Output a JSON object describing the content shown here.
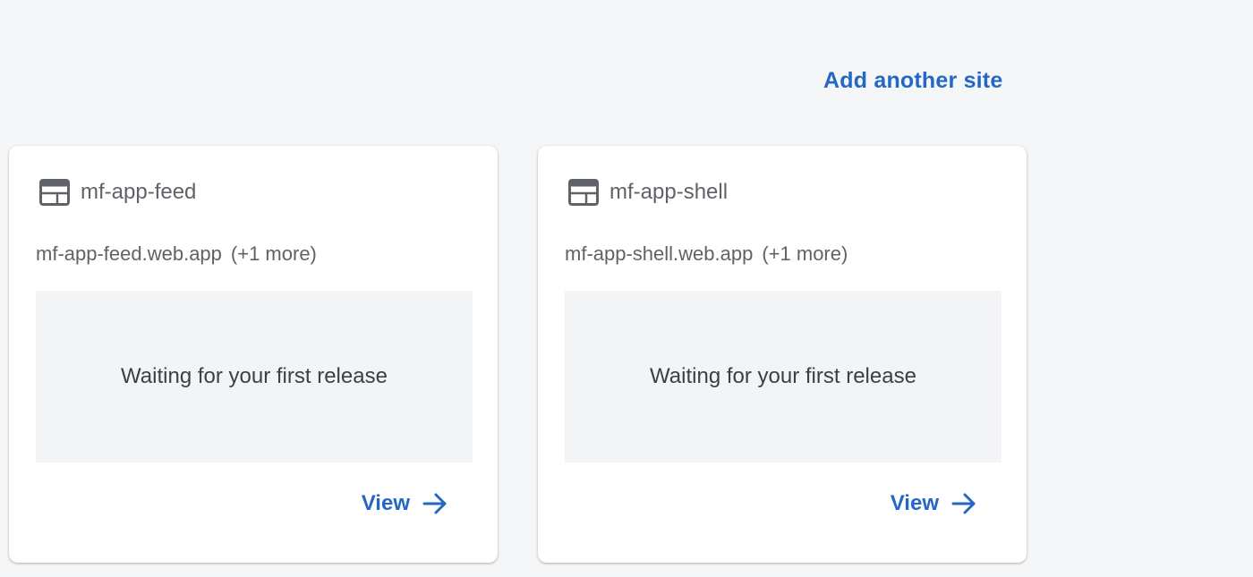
{
  "header": {
    "add_site_label": "Add another site"
  },
  "sites": [
    {
      "name": "mf-app-feed",
      "url": "mf-app-feed.web.app",
      "more": "(+1 more)",
      "status": "Waiting for your first release",
      "view_label": "View"
    },
    {
      "name": "mf-app-shell",
      "url": "mf-app-shell.web.app",
      "more": "(+1 more)",
      "status": "Waiting for your first release",
      "view_label": "View"
    }
  ],
  "icons": {
    "site": "web-layout-icon",
    "view": "arrow-right-icon"
  },
  "colors": {
    "accent": "#2467c6",
    "text_secondary": "#5f6368",
    "background": "#f5f6f8"
  }
}
